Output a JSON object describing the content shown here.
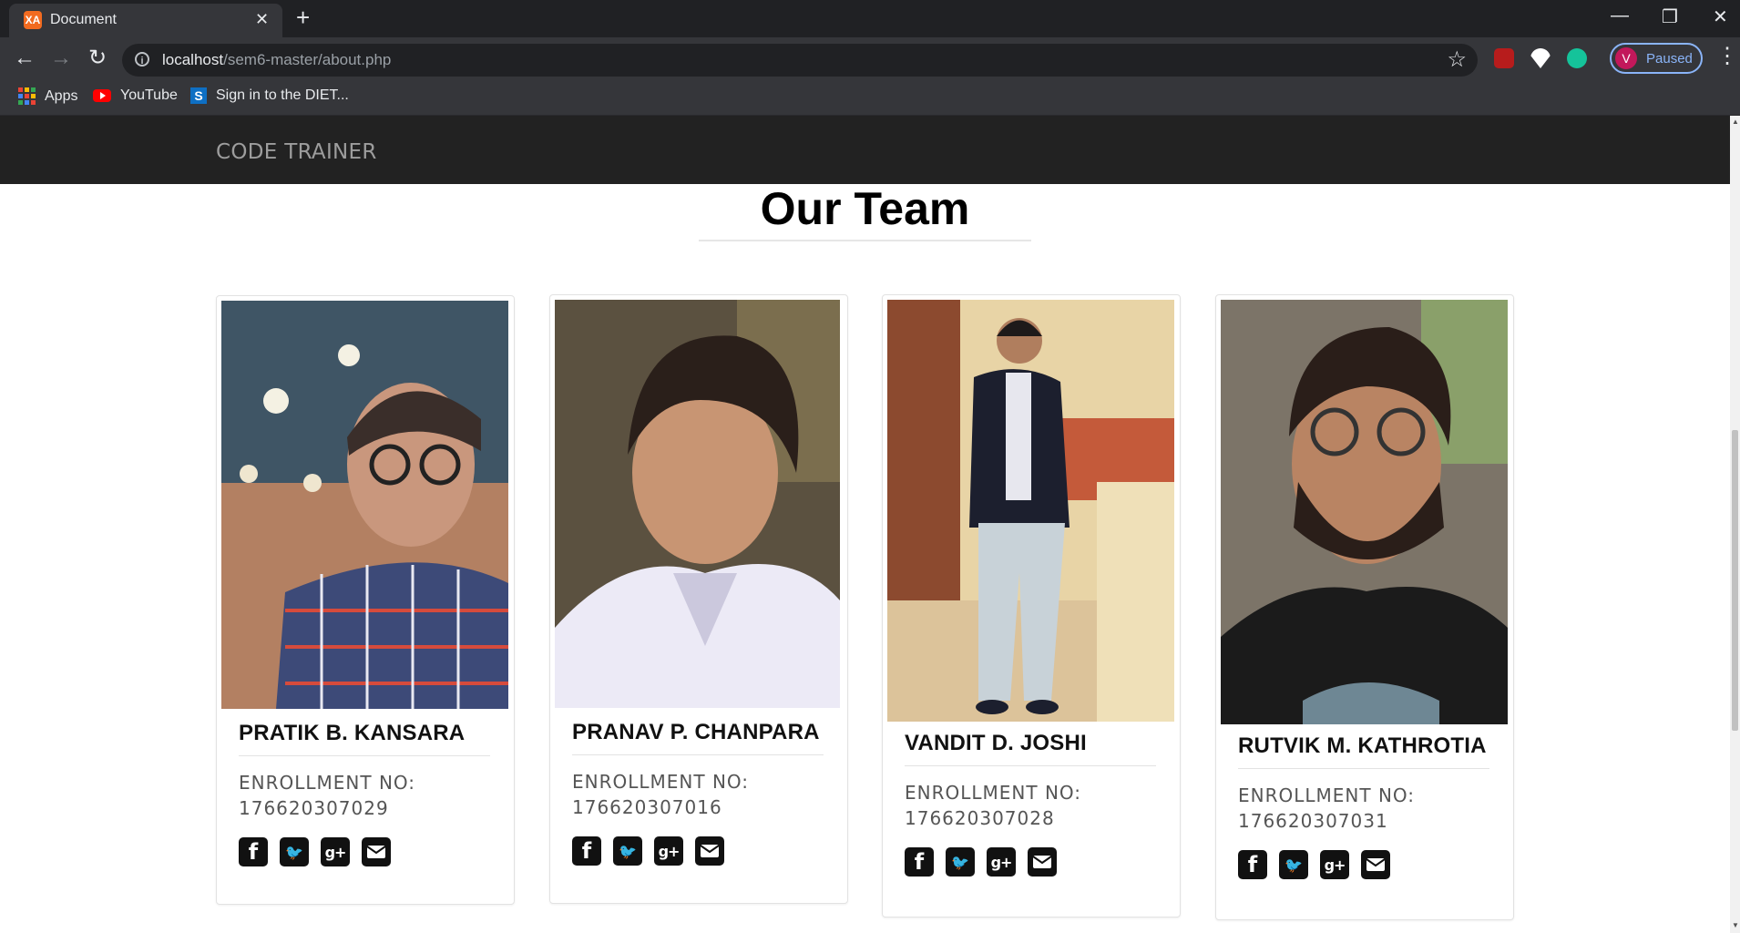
{
  "browser": {
    "tab_title": "Document",
    "tab_favicon_text": "XA",
    "url_host": "localhost",
    "url_path": "/sem6-master/about.php",
    "profile_initial": "V",
    "profile_status": "Paused",
    "bookmarks": [
      "Apps",
      "YouTube",
      "Sign in to the DIET..."
    ]
  },
  "site": {
    "brand": "CODE TRAINER",
    "heading": "Our Team"
  },
  "team": [
    {
      "name": "PRATIK B. KANSARA",
      "enroll_label": "ENROLLMENT NO:",
      "enroll_no": "176620307029"
    },
    {
      "name": "PRANAV P. CHANPARA",
      "enroll_label": "ENROLLMENT NO:",
      "enroll_no": "176620307016"
    },
    {
      "name": "VANDIT D. JOSHI",
      "enroll_label": "ENROLLMENT NO:",
      "enroll_no": "176620307028"
    },
    {
      "name": "RUTVIK M. KATHROTIA",
      "enroll_label": "ENROLLMENT NO:",
      "enroll_no": "176620307031"
    }
  ],
  "social_icons": [
    "facebook-icon",
    "twitter-icon",
    "google-plus-icon",
    "email-icon"
  ],
  "colors": {
    "navbar_bg": "#222222",
    "brand_text": "#9d9d9d",
    "chrome_dark": "#202124",
    "chrome_toolbar": "#35363a",
    "profile_accent": "#8ab4f8"
  }
}
